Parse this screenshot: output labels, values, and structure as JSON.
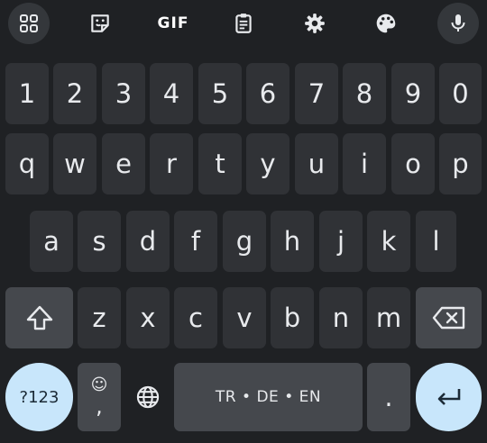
{
  "toolbar": {
    "gif_label": "GIF",
    "icons": [
      "apps-grid-icon",
      "sticker-icon",
      "gif-icon",
      "clipboard-icon",
      "settings-icon",
      "palette-icon",
      "microphone-icon"
    ]
  },
  "rows": {
    "numbers": [
      "1",
      "2",
      "3",
      "4",
      "5",
      "6",
      "7",
      "8",
      "9",
      "0"
    ],
    "row1": [
      "q",
      "w",
      "e",
      "r",
      "t",
      "y",
      "u",
      "i",
      "o",
      "p"
    ],
    "row2": [
      "a",
      "s",
      "d",
      "f",
      "g",
      "h",
      "j",
      "k",
      "l"
    ],
    "row3": [
      "z",
      "x",
      "c",
      "v",
      "b",
      "n",
      "m"
    ]
  },
  "bottom": {
    "symbols_label": "?123",
    "emoji_top": "☺",
    "emoji_bottom": ",",
    "space_label": "TR • DE • EN",
    "period_label": "."
  },
  "colors": {
    "background": "#1f2124",
    "key": "#303236",
    "function_key": "#45484d",
    "accent": "#c8e6fb"
  }
}
